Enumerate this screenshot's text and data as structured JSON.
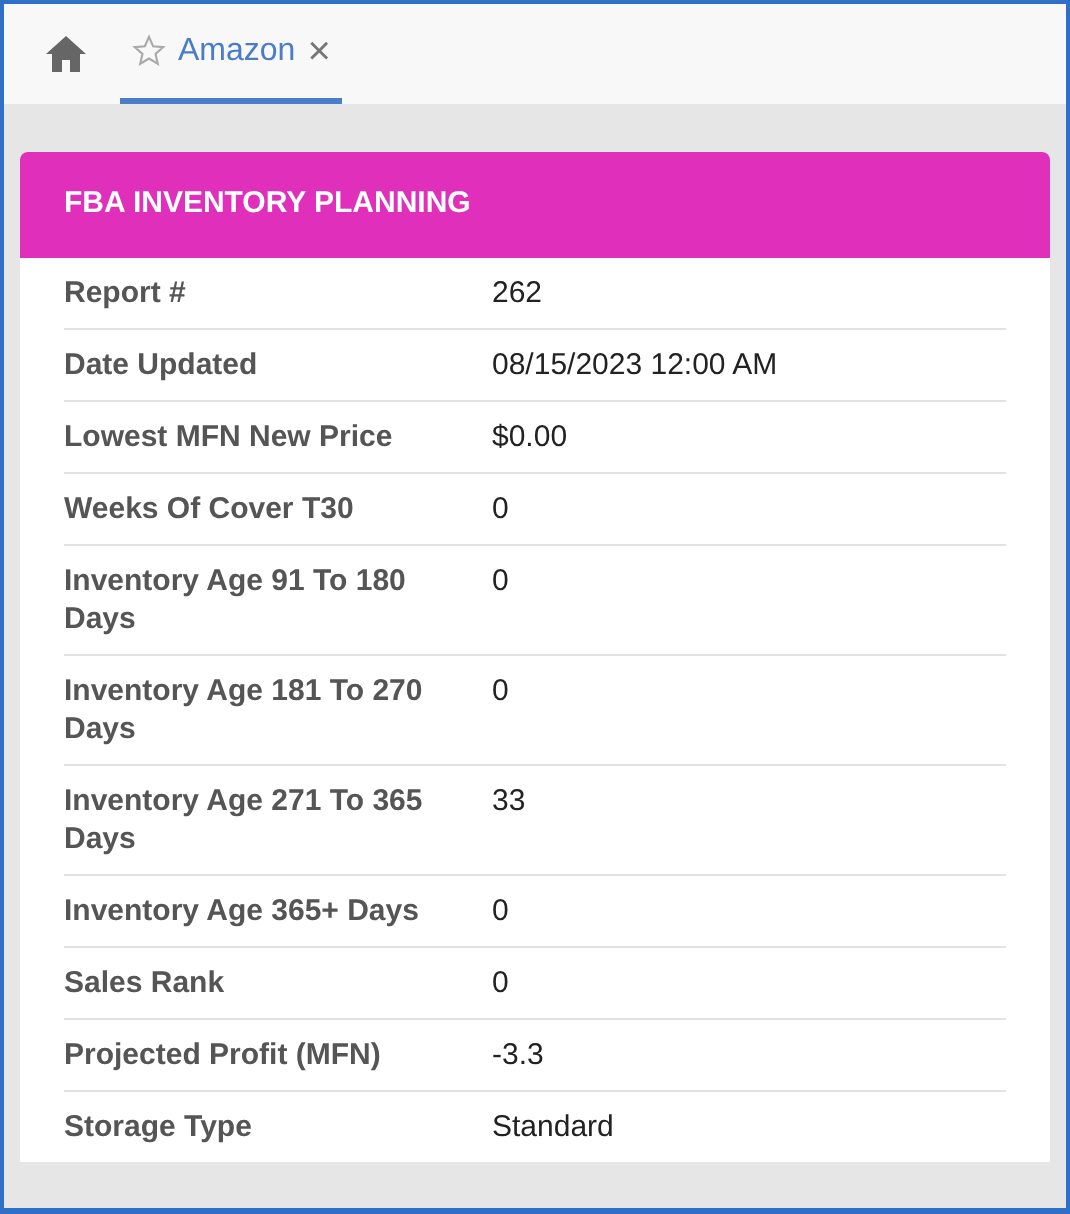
{
  "tabs": [
    {
      "label": "Amazon",
      "close": "×",
      "selected": true
    }
  ],
  "panel": {
    "title": "FBA INVENTORY PLANNING",
    "rows": [
      {
        "label": "Report #",
        "value": "262"
      },
      {
        "label": "Date Updated",
        "value": "08/15/2023 12:00 AM"
      },
      {
        "label": "Lowest MFN New Price",
        "value": "$0.00"
      },
      {
        "label": "Weeks Of Cover T30",
        "value": "0"
      },
      {
        "label": "Inventory Age 91 To 180 Days",
        "value": "0"
      },
      {
        "label": "Inventory Age 181 To 270 Days",
        "value": "0"
      },
      {
        "label": "Inventory Age 271 To 365 Days",
        "value": "33"
      },
      {
        "label": "Inventory Age 365+ Days",
        "value": "0"
      },
      {
        "label": "Sales Rank",
        "value": "0"
      },
      {
        "label": "Projected Profit (MFN)",
        "value": "-3.3"
      },
      {
        "label": "Storage Type",
        "value": "Standard"
      }
    ]
  }
}
